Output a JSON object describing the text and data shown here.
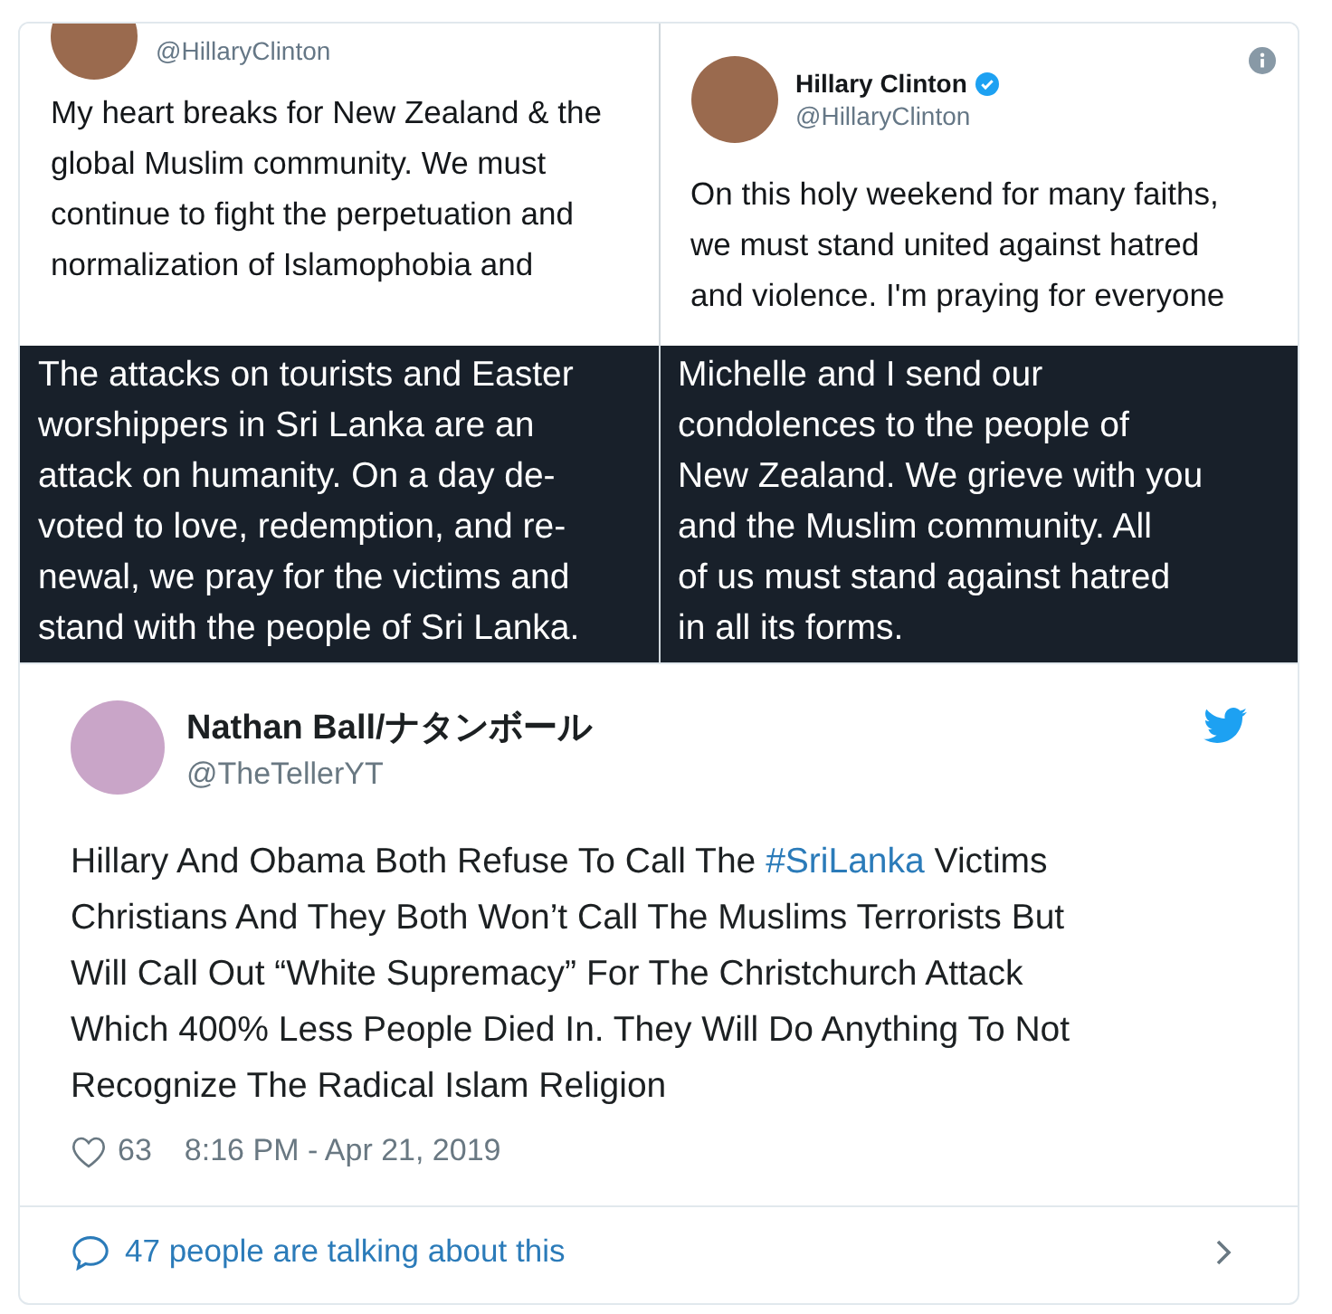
{
  "embedded_image": {
    "panels": [
      {
        "handle": "@HillaryClinton",
        "text": "My heart breaks for New Zealand & the\nglobal Muslim community. We must\ncontinue to fight the perpetuation and\nnormalization of Islamophobia and",
        "caption": "The attacks on tourists and Easter\nworshippers in Sri Lanka are an\nattack on humanity. On a day de-\nvoted to love, redemption, and re-\nnewal, we pray for the victims and\nstand with the people of Sri Lanka."
      },
      {
        "name": "Hillary Clinton",
        "verified": true,
        "handle": "@HillaryClinton",
        "text": "On this holy weekend for many faiths,\nwe must stand united against hatred\nand violence. I'm praying for everyone",
        "caption": "Michelle and I send our\ncondolences to the people of\nNew Zealand. We grieve with you\nand the Muslim community. All\nof us must stand against hatred\nin all its forms."
      }
    ]
  },
  "tweet": {
    "author": "Nathan Ball/ナタンボール",
    "handle": "@TheTellerYT",
    "text_before": "Hillary And Obama Both Refuse To Call The ",
    "hashtag": "#SriLanka",
    "text_after": " Victims\nChristians And They Both Won’t Call The Muslims Terrorists But\nWill Call Out “White Supremacy” For The Christchurch Attack\nWhich 400% Less People Died In. They Will Do Anything To Not\nRecognize The Radical Islam Religion",
    "likes": "63",
    "timestamp": "8:16 PM - Apr 21, 2019"
  },
  "footer": {
    "text": "47 people are talking about this"
  }
}
